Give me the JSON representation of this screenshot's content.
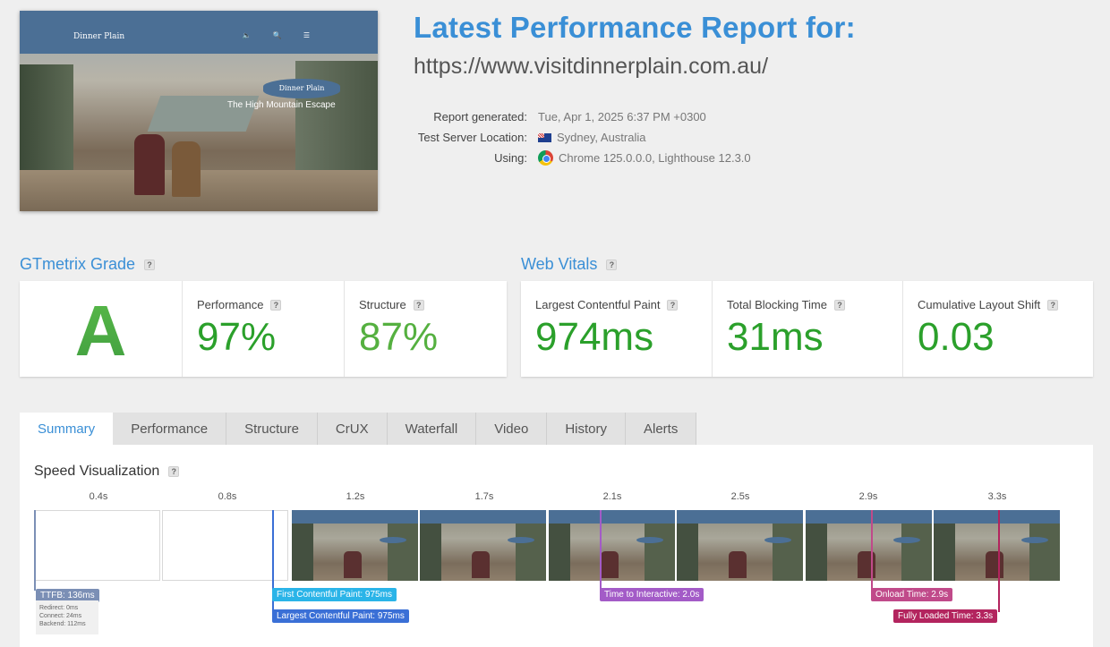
{
  "screenshot": {
    "site_logo": "Dinner Plain",
    "badge": "Dinner Plain",
    "tagline": "The High Mountain Escape"
  },
  "report": {
    "title": "Latest Performance Report for:",
    "url": "https://www.visitdinnerplain.com.au/",
    "meta": [
      {
        "label": "Report generated:",
        "value": "Tue, Apr 1, 2025 6:37 PM +0300",
        "icon": ""
      },
      {
        "label": "Test Server Location:",
        "value": "Sydney, Australia",
        "icon": "australia-flag-icon"
      },
      {
        "label": "Using:",
        "value": "Chrome 125.0.0.0, Lighthouse 12.3.0",
        "icon": "chrome-icon"
      }
    ]
  },
  "grade": {
    "heading": "GTmetrix Grade",
    "letter": "A",
    "performance_label": "Performance",
    "performance_value": "97%",
    "structure_label": "Structure",
    "structure_value": "87%"
  },
  "vitals": {
    "heading": "Web Vitals",
    "lcp_label": "Largest Contentful Paint",
    "lcp_value": "974ms",
    "tbt_label": "Total Blocking Time",
    "tbt_value": "31ms",
    "cls_label": "Cumulative Layout Shift",
    "cls_value": "0.03"
  },
  "tabs": [
    "Summary",
    "Performance",
    "Structure",
    "CrUX",
    "Waterfall",
    "Video",
    "History",
    "Alerts"
  ],
  "active_tab": "Summary",
  "speed": {
    "heading": "Speed Visualization",
    "ticks": [
      "0.4s",
      "0.8s",
      "1.2s",
      "1.7s",
      "2.1s",
      "2.5s",
      "2.9s",
      "3.3s"
    ],
    "frames_blank": 2,
    "markers": {
      "ttfb": "TTFB: 136ms",
      "ttfb_redirect": "Redirect: 0ms",
      "ttfb_connect": "Connect: 24ms",
      "ttfb_backend": "Backend: 112ms",
      "fcp": "First Contentful Paint: 975ms",
      "lcp": "Largest Contentful Paint: 975ms",
      "tti": "Time to Interactive: 2.0s",
      "onload": "Onload Time: 2.9s",
      "fully_loaded": "Fully Loaded Time: 3.3s"
    },
    "colors": {
      "ttfb": "#7b8fb5",
      "fcp": "#2ab4e8",
      "lcp": "#3a6fd6",
      "tti": "#a35bc7",
      "onload": "#c04a8a",
      "fully_loaded": "#b3245e"
    }
  }
}
